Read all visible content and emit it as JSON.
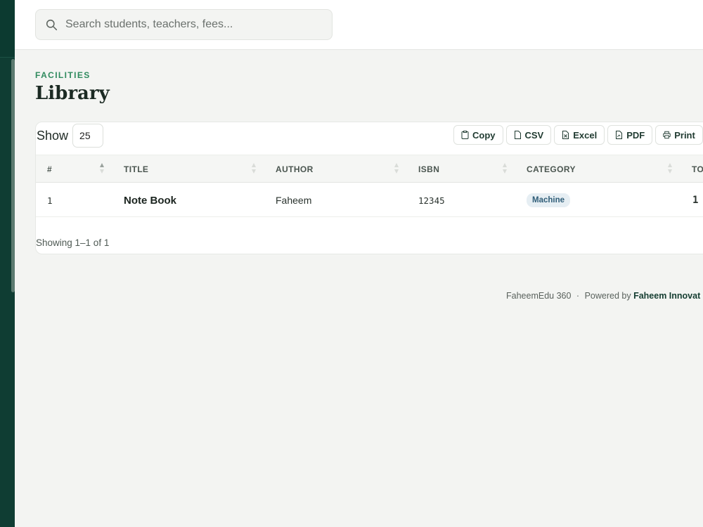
{
  "search": {
    "placeholder": "Search students, teachers, fees..."
  },
  "page": {
    "eyebrow": "FACILITIES",
    "title": "Library"
  },
  "table_controls": {
    "show_label": "Show",
    "page_size": "25",
    "export_buttons": [
      "Copy",
      "CSV",
      "Excel",
      "PDF",
      "Print"
    ]
  },
  "table": {
    "columns": [
      "#",
      "TITLE",
      "AUTHOR",
      "ISBN",
      "CATEGORY",
      "TO"
    ],
    "rows": [
      {
        "num": "1",
        "title": "Note Book",
        "author": "Faheem",
        "isbn": "12345",
        "category": "Machine",
        "total": "1"
      }
    ],
    "showing": "Showing 1–1 of 1"
  },
  "footer": {
    "product": "FaheemEdu 360",
    "separator": "·",
    "powered_by": "Powered by",
    "company": "Faheem Innovat"
  },
  "colors": {
    "sidebar": "#0f3d33",
    "accent": "#2f8a5e",
    "badge_bg": "#e6eef3"
  }
}
